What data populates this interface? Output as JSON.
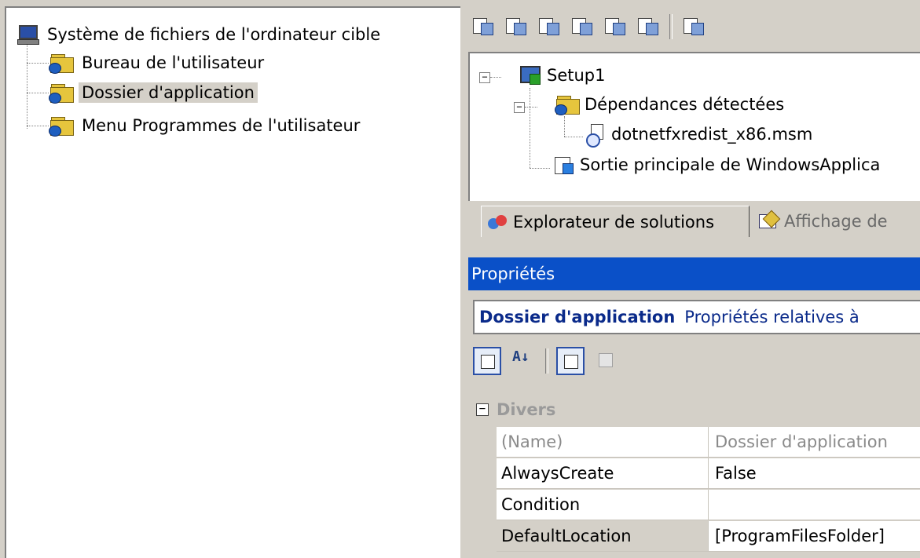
{
  "filesystem_tree": {
    "root": "Système de fichiers de l'ordinateur cible",
    "items": [
      {
        "label": "Bureau de l'utilisateur"
      },
      {
        "label": "Dossier d'application",
        "selected": true
      },
      {
        "label": "Menu Programmes de l'utilisateur"
      }
    ]
  },
  "solution_tree": {
    "project": "Setup1",
    "dependencies": "Dépendances détectées",
    "dependency_file": "dotnetfxredist_x86.msm",
    "primary_output": "Sortie principale de WindowsApplica",
    "expand_glyph": "−"
  },
  "tabs": {
    "solution_explorer": "Explorateur de solutions",
    "view": "Affichage de"
  },
  "properties": {
    "title": "Propriétés",
    "object_name": "Dossier d'application",
    "object_desc": "Propriétés relatives à",
    "toolbar": {
      "alpha_label": "A↓"
    },
    "category": "Divers",
    "collapse_glyph": "−",
    "rows": [
      {
        "name": "(Name)",
        "value": "Dossier d'application"
      },
      {
        "name": "AlwaysCreate",
        "value": "False"
      },
      {
        "name": "Condition",
        "value": ""
      },
      {
        "name": "DefaultLocation",
        "value": "[ProgramFilesFolder]"
      }
    ]
  },
  "colors": {
    "title_bar": "#0a50c8",
    "window_bg": "#d4d0c8",
    "folder": "#e6c53d"
  }
}
